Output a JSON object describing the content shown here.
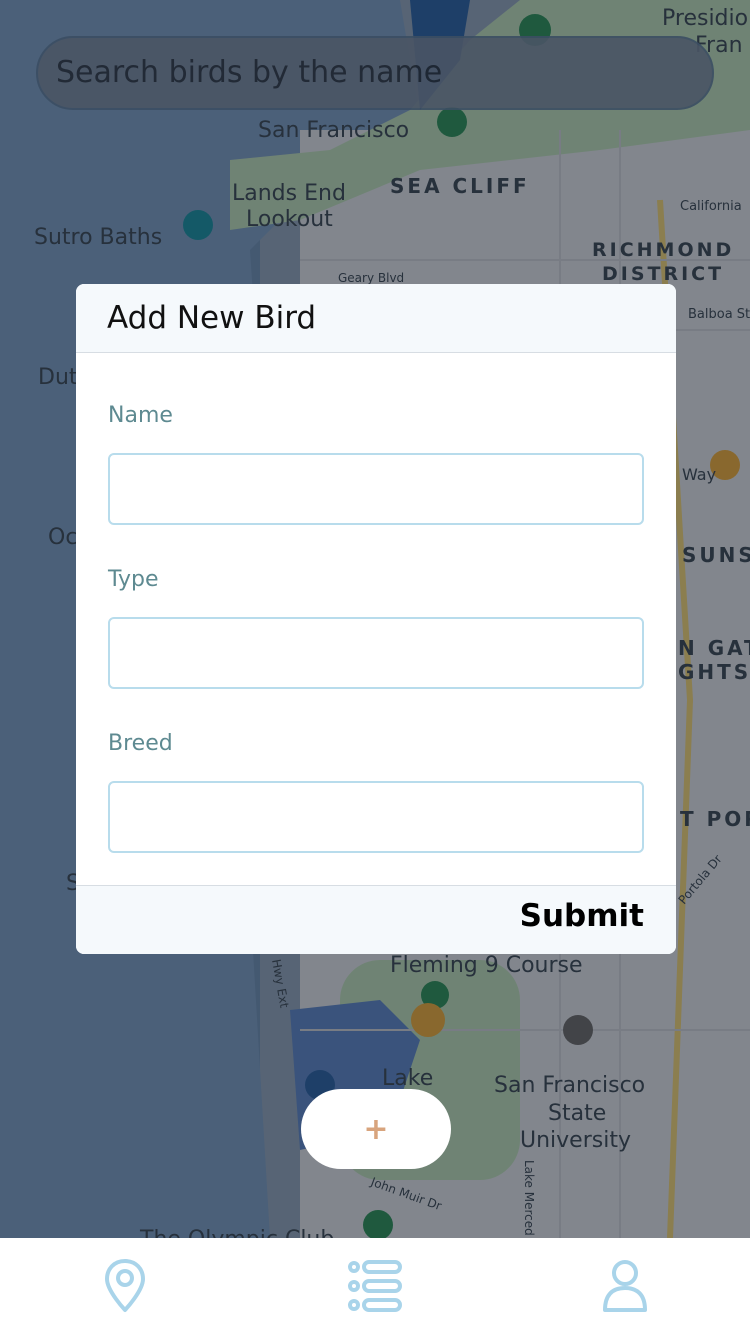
{
  "search": {
    "placeholder": "Search birds by the name"
  },
  "map": {
    "labels": [
      "Presidio",
      "Fran",
      "Land's End,\nSan Francisco",
      "Lands End\nLookout",
      "SEA CLIFF",
      "Sutro Baths",
      "California",
      "RICHMOND\nDISTRICT",
      "Geary Blvd",
      "Balboa St",
      "Dut",
      "Way",
      "Oc",
      "SUNS",
      "N GAT\nGHTS",
      "T POR",
      "Portola Dr",
      "S",
      "Fleming 9 Course",
      "Lake\nMerced Park",
      "San Francisco\nState\nUniversity",
      "Lake Merced Blvd",
      "John Muir Dr",
      "The Olympic Club",
      "Hwy Ext"
    ]
  },
  "modal": {
    "title": "Add New Bird",
    "fields": [
      {
        "label": "Name",
        "value": ""
      },
      {
        "label": "Type",
        "value": ""
      },
      {
        "label": "Breed",
        "value": ""
      }
    ],
    "submit_label": "Submit"
  },
  "add_button": {
    "label": "+"
  },
  "tabbar": {
    "items": [
      {
        "icon": "map-pin-icon"
      },
      {
        "icon": "list-icon"
      },
      {
        "icon": "user-icon"
      }
    ]
  },
  "colors": {
    "accent": "#a9d4ea",
    "label": "#5e8a91",
    "plus": "#d8a47d"
  }
}
